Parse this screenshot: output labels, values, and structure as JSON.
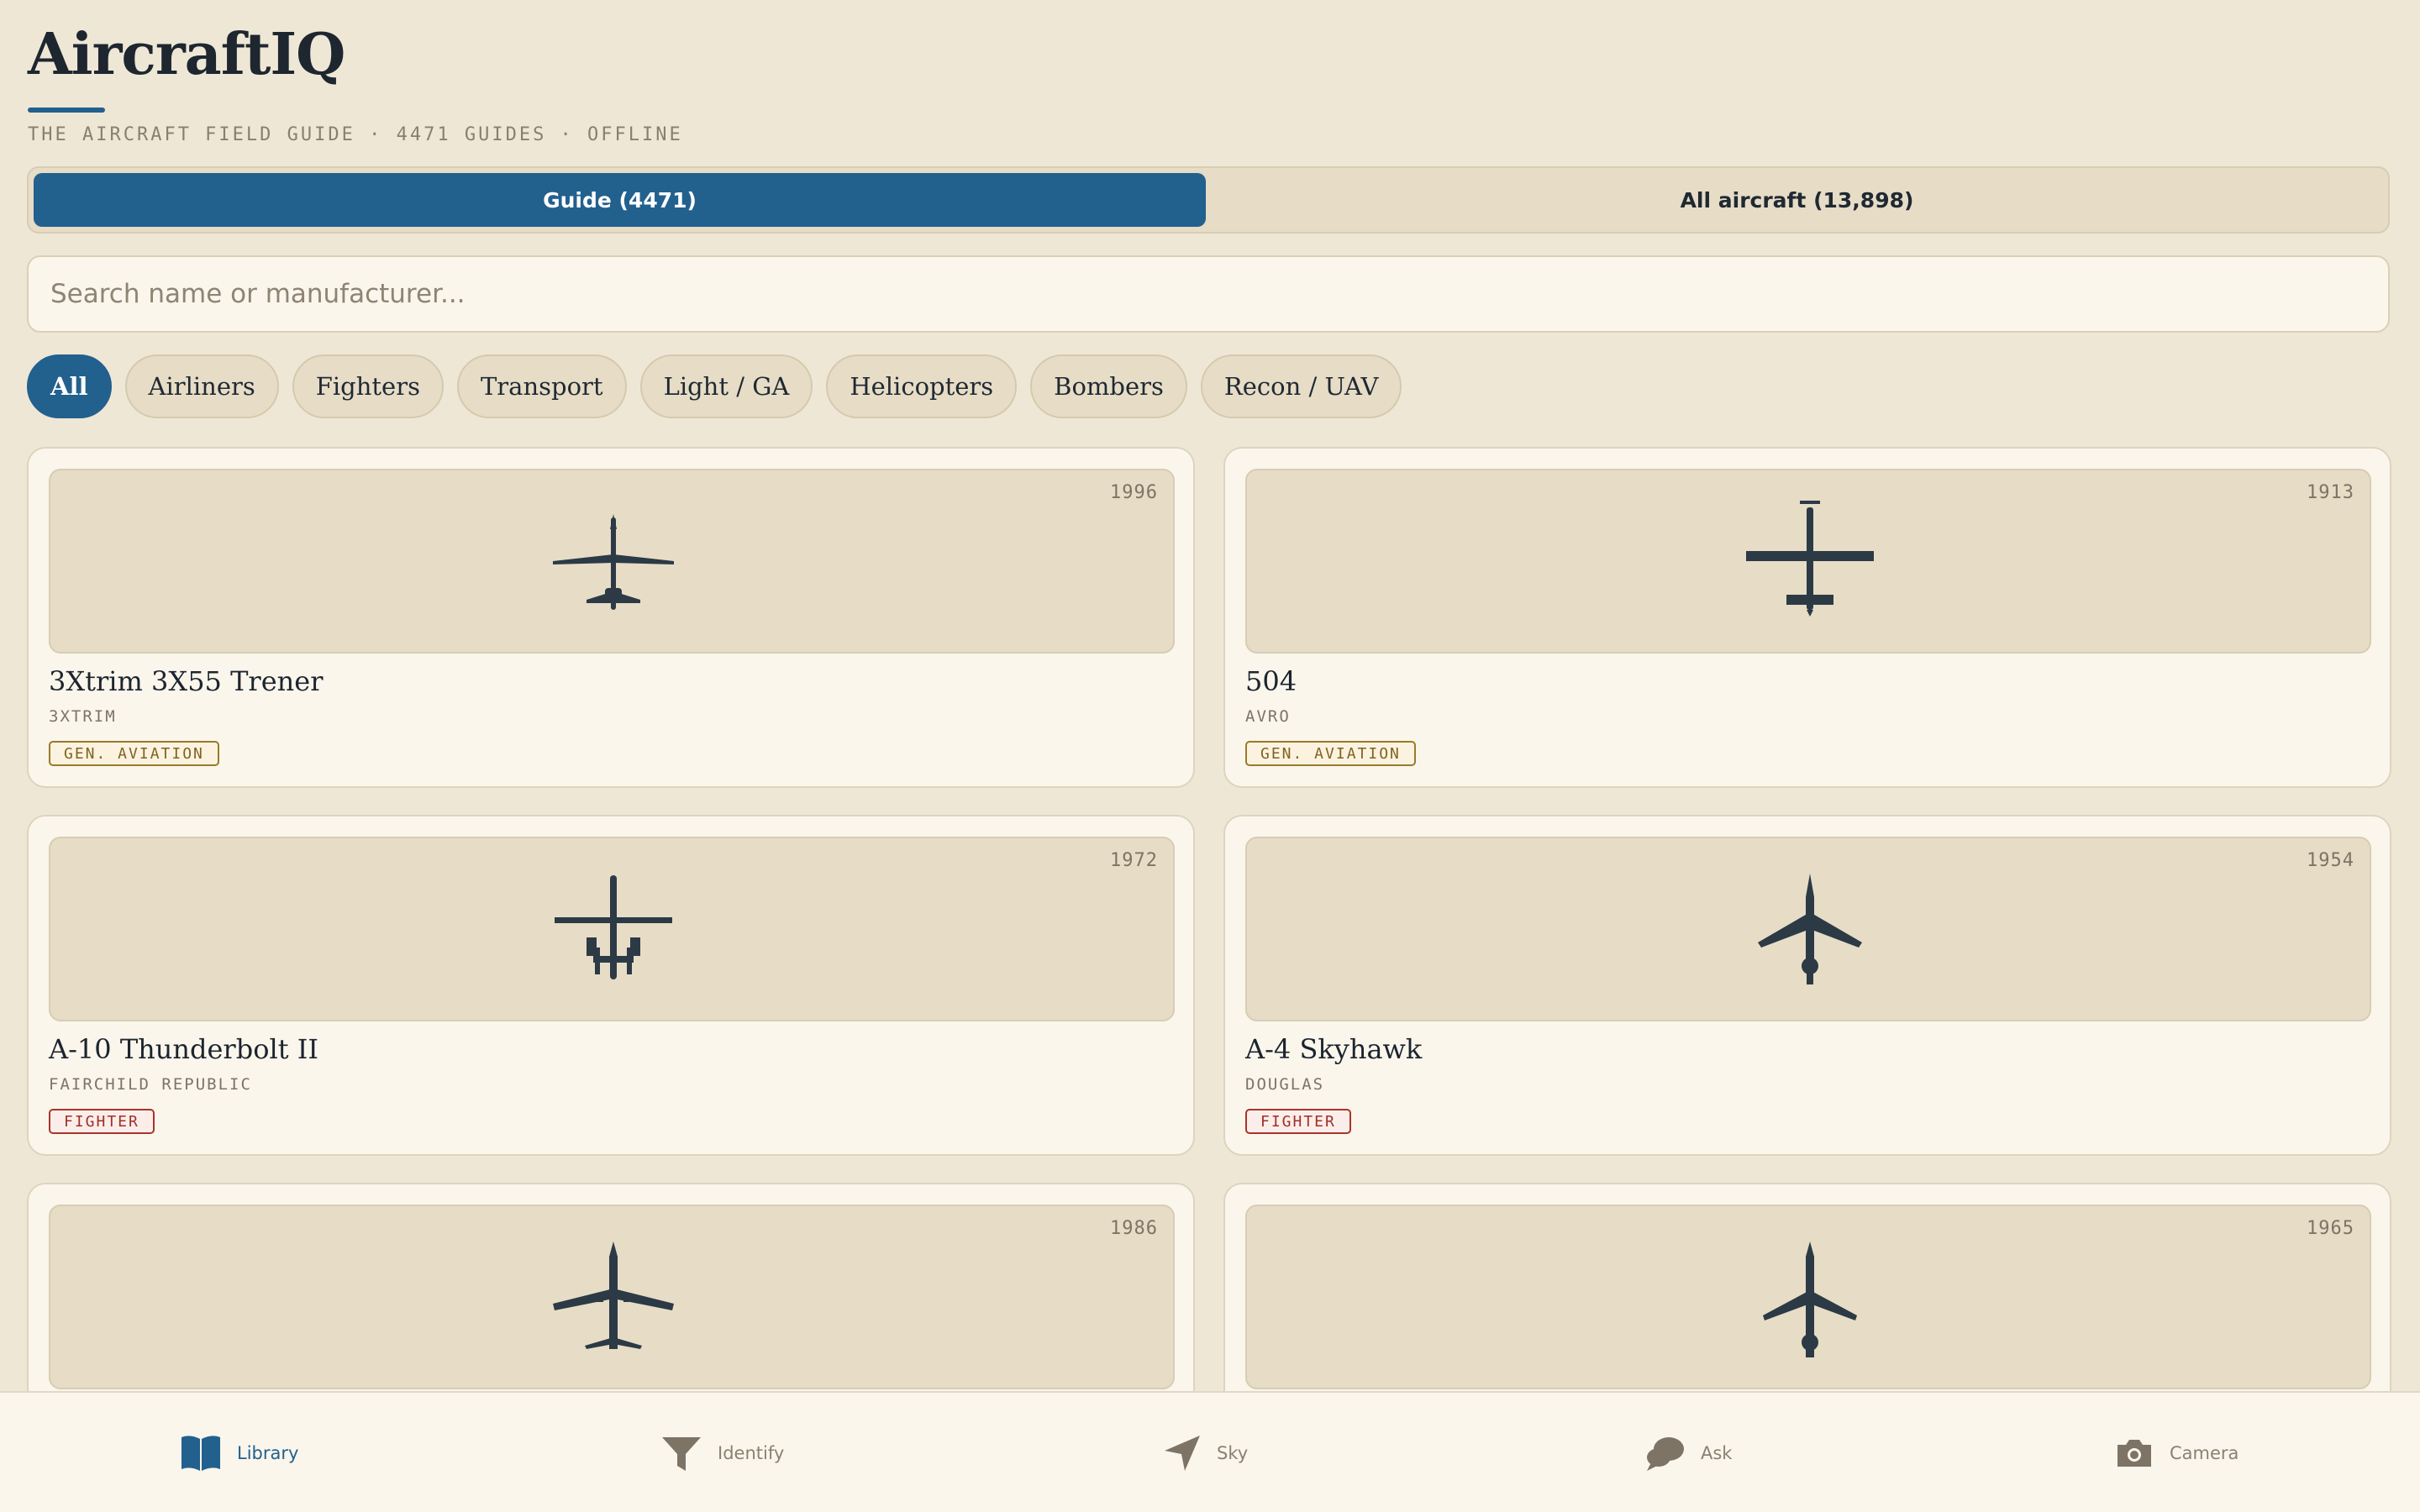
{
  "app": {
    "title": "AircraftIQ",
    "subtitle": "THE AIRCRAFT FIELD GUIDE · 4471 GUIDES · OFFLINE"
  },
  "toggle": {
    "guide_label": "Guide (4471)",
    "all_label": "All aircraft (13,898)",
    "selected": "guide"
  },
  "search": {
    "placeholder": "Search name or manufacturer...",
    "value": ""
  },
  "filters": {
    "selected": "All",
    "chips": [
      "All",
      "Airliners",
      "Fighters",
      "Transport",
      "Light / GA",
      "Helicopters",
      "Bombers",
      "Recon / UAV"
    ]
  },
  "cards": [
    {
      "name": "3Xtrim 3X55 Trener",
      "manufacturer": "3XTRIM",
      "year": "1996",
      "category": "GEN. AVIATION",
      "icon": "light-aircraft-icon"
    },
    {
      "name": "504",
      "manufacturer": "AVRO",
      "year": "1913",
      "category": "GEN. AVIATION",
      "icon": "biplane-icon"
    },
    {
      "name": "A-10 Thunderbolt II",
      "manufacturer": "FAIRCHILD REPUBLIC",
      "year": "1972",
      "category": "FIGHTER",
      "icon": "attack-jet-icon"
    },
    {
      "name": "A-4 Skyhawk",
      "manufacturer": "DOUGLAS",
      "year": "1954",
      "category": "FIGHTER",
      "icon": "swept-jet-icon"
    },
    {
      "name": "",
      "manufacturer": "",
      "year": "1986",
      "category": "",
      "icon": "airliner-icon"
    },
    {
      "name": "",
      "manufacturer": "",
      "year": "1965",
      "category": "",
      "icon": "jet-icon"
    }
  ],
  "bottom_nav": {
    "items": [
      {
        "label": "Library",
        "icon": "book-icon"
      },
      {
        "label": "Identify",
        "icon": "filter-icon"
      },
      {
        "label": "Sky",
        "icon": "navigation-arrow-icon"
      },
      {
        "label": "Ask",
        "icon": "chat-bubbles-icon"
      },
      {
        "label": "Camera",
        "icon": "camera-icon"
      }
    ],
    "active": "Library"
  },
  "colors": {
    "accent": "#22608e",
    "background": "#efe7d6",
    "card": "#faf6ec",
    "silhouette": "#2c3a46",
    "ga_badge": "#9a7a2a",
    "fighter_badge": "#a8342a"
  }
}
